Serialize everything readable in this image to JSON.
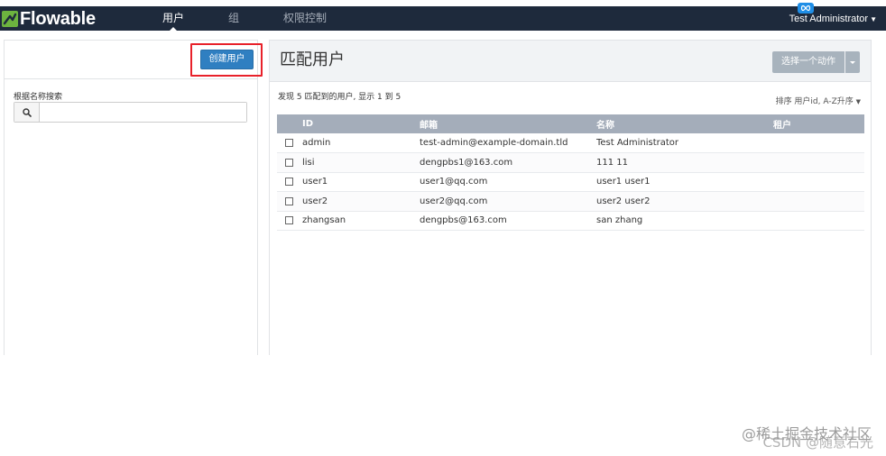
{
  "navbar": {
    "brand": "Flowable",
    "items": [
      {
        "label": "用户",
        "active": true
      },
      {
        "label": "组",
        "active": false
      },
      {
        "label": "权限控制",
        "active": false
      }
    ],
    "user": "Test Administrator",
    "bg_color": "#1e2a3c",
    "brand_color": "#6cb33f"
  },
  "sidebar": {
    "create_button": "创建用户",
    "search_label": "根据名称搜索",
    "search_value": "",
    "highlight_color": "#e8212a"
  },
  "main": {
    "title": "匹配用户",
    "action_button": "选择一个动作",
    "result_summary": "发现 5 匹配到的用户, 显示 1 到 5",
    "sort_label": "排序 用户id, A-Z升序",
    "table": {
      "headers": [
        "ID",
        "邮箱",
        "名称",
        "租户"
      ],
      "rows": [
        {
          "id": "admin",
          "email": "test-admin@example-domain.tld",
          "name": "Test Administrator",
          "tenant": ""
        },
        {
          "id": "lisi",
          "email": "dengpbs1@163.com",
          "name": "111 11",
          "tenant": ""
        },
        {
          "id": "user1",
          "email": "user1@qq.com",
          "name": "user1 user1",
          "tenant": ""
        },
        {
          "id": "user2",
          "email": "user2@qq.com",
          "name": "user2 user2",
          "tenant": ""
        },
        {
          "id": "zhangsan",
          "email": "dengpbs@163.com",
          "name": "san zhang",
          "tenant": ""
        }
      ]
    }
  },
  "watermark": {
    "line1": "@稀土掘金技术社区",
    "line2": "CSDN @随意石光"
  }
}
